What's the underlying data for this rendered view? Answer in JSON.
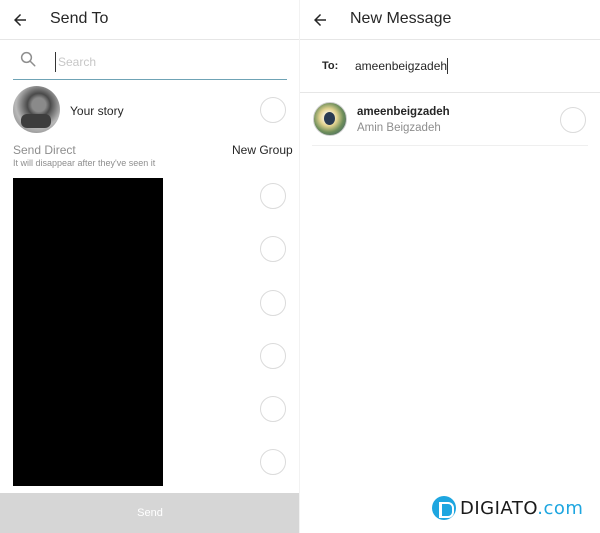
{
  "send_to": {
    "header": {
      "title": "Send To"
    },
    "search": {
      "placeholder": "Search",
      "value": ""
    },
    "story": {
      "label": "Your story"
    },
    "direct": {
      "title": "Send Direct",
      "subtitle": "It will disappear after they've seen it",
      "new_group_label": "New Group"
    },
    "recipient_rows": 6,
    "send_button_label": "Send"
  },
  "new_message": {
    "header": {
      "title": "New Message"
    },
    "to": {
      "label": "To:",
      "value": "ameenbeigzadeh"
    },
    "results": [
      {
        "username": "ameenbeigzadeh",
        "full_name": "Amin Beigzadeh"
      }
    ]
  },
  "watermark": {
    "brand": "DIGIATO",
    "suffix": ".com",
    "color": "#1ea6e0"
  }
}
